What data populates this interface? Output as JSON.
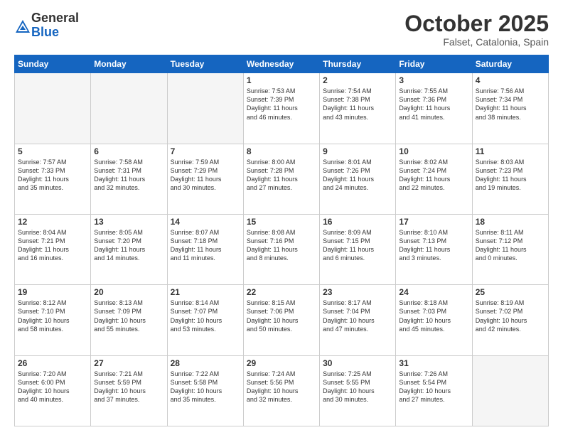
{
  "header": {
    "logo_general": "General",
    "logo_blue": "Blue",
    "month": "October 2025",
    "location": "Falset, Catalonia, Spain"
  },
  "weekdays": [
    "Sunday",
    "Monday",
    "Tuesday",
    "Wednesday",
    "Thursday",
    "Friday",
    "Saturday"
  ],
  "weeks": [
    [
      {
        "num": "",
        "text": ""
      },
      {
        "num": "",
        "text": ""
      },
      {
        "num": "",
        "text": ""
      },
      {
        "num": "1",
        "text": "Sunrise: 7:53 AM\nSunset: 7:39 PM\nDaylight: 11 hours\nand 46 minutes."
      },
      {
        "num": "2",
        "text": "Sunrise: 7:54 AM\nSunset: 7:38 PM\nDaylight: 11 hours\nand 43 minutes."
      },
      {
        "num": "3",
        "text": "Sunrise: 7:55 AM\nSunset: 7:36 PM\nDaylight: 11 hours\nand 41 minutes."
      },
      {
        "num": "4",
        "text": "Sunrise: 7:56 AM\nSunset: 7:34 PM\nDaylight: 11 hours\nand 38 minutes."
      }
    ],
    [
      {
        "num": "5",
        "text": "Sunrise: 7:57 AM\nSunset: 7:33 PM\nDaylight: 11 hours\nand 35 minutes."
      },
      {
        "num": "6",
        "text": "Sunrise: 7:58 AM\nSunset: 7:31 PM\nDaylight: 11 hours\nand 32 minutes."
      },
      {
        "num": "7",
        "text": "Sunrise: 7:59 AM\nSunset: 7:29 PM\nDaylight: 11 hours\nand 30 minutes."
      },
      {
        "num": "8",
        "text": "Sunrise: 8:00 AM\nSunset: 7:28 PM\nDaylight: 11 hours\nand 27 minutes."
      },
      {
        "num": "9",
        "text": "Sunrise: 8:01 AM\nSunset: 7:26 PM\nDaylight: 11 hours\nand 24 minutes."
      },
      {
        "num": "10",
        "text": "Sunrise: 8:02 AM\nSunset: 7:24 PM\nDaylight: 11 hours\nand 22 minutes."
      },
      {
        "num": "11",
        "text": "Sunrise: 8:03 AM\nSunset: 7:23 PM\nDaylight: 11 hours\nand 19 minutes."
      }
    ],
    [
      {
        "num": "12",
        "text": "Sunrise: 8:04 AM\nSunset: 7:21 PM\nDaylight: 11 hours\nand 16 minutes."
      },
      {
        "num": "13",
        "text": "Sunrise: 8:05 AM\nSunset: 7:20 PM\nDaylight: 11 hours\nand 14 minutes."
      },
      {
        "num": "14",
        "text": "Sunrise: 8:07 AM\nSunset: 7:18 PM\nDaylight: 11 hours\nand 11 minutes."
      },
      {
        "num": "15",
        "text": "Sunrise: 8:08 AM\nSunset: 7:16 PM\nDaylight: 11 hours\nand 8 minutes."
      },
      {
        "num": "16",
        "text": "Sunrise: 8:09 AM\nSunset: 7:15 PM\nDaylight: 11 hours\nand 6 minutes."
      },
      {
        "num": "17",
        "text": "Sunrise: 8:10 AM\nSunset: 7:13 PM\nDaylight: 11 hours\nand 3 minutes."
      },
      {
        "num": "18",
        "text": "Sunrise: 8:11 AM\nSunset: 7:12 PM\nDaylight: 11 hours\nand 0 minutes."
      }
    ],
    [
      {
        "num": "19",
        "text": "Sunrise: 8:12 AM\nSunset: 7:10 PM\nDaylight: 10 hours\nand 58 minutes."
      },
      {
        "num": "20",
        "text": "Sunrise: 8:13 AM\nSunset: 7:09 PM\nDaylight: 10 hours\nand 55 minutes."
      },
      {
        "num": "21",
        "text": "Sunrise: 8:14 AM\nSunset: 7:07 PM\nDaylight: 10 hours\nand 53 minutes."
      },
      {
        "num": "22",
        "text": "Sunrise: 8:15 AM\nSunset: 7:06 PM\nDaylight: 10 hours\nand 50 minutes."
      },
      {
        "num": "23",
        "text": "Sunrise: 8:17 AM\nSunset: 7:04 PM\nDaylight: 10 hours\nand 47 minutes."
      },
      {
        "num": "24",
        "text": "Sunrise: 8:18 AM\nSunset: 7:03 PM\nDaylight: 10 hours\nand 45 minutes."
      },
      {
        "num": "25",
        "text": "Sunrise: 8:19 AM\nSunset: 7:02 PM\nDaylight: 10 hours\nand 42 minutes."
      }
    ],
    [
      {
        "num": "26",
        "text": "Sunrise: 7:20 AM\nSunset: 6:00 PM\nDaylight: 10 hours\nand 40 minutes."
      },
      {
        "num": "27",
        "text": "Sunrise: 7:21 AM\nSunset: 5:59 PM\nDaylight: 10 hours\nand 37 minutes."
      },
      {
        "num": "28",
        "text": "Sunrise: 7:22 AM\nSunset: 5:58 PM\nDaylight: 10 hours\nand 35 minutes."
      },
      {
        "num": "29",
        "text": "Sunrise: 7:24 AM\nSunset: 5:56 PM\nDaylight: 10 hours\nand 32 minutes."
      },
      {
        "num": "30",
        "text": "Sunrise: 7:25 AM\nSunset: 5:55 PM\nDaylight: 10 hours\nand 30 minutes."
      },
      {
        "num": "31",
        "text": "Sunrise: 7:26 AM\nSunset: 5:54 PM\nDaylight: 10 hours\nand 27 minutes."
      },
      {
        "num": "",
        "text": ""
      }
    ]
  ]
}
